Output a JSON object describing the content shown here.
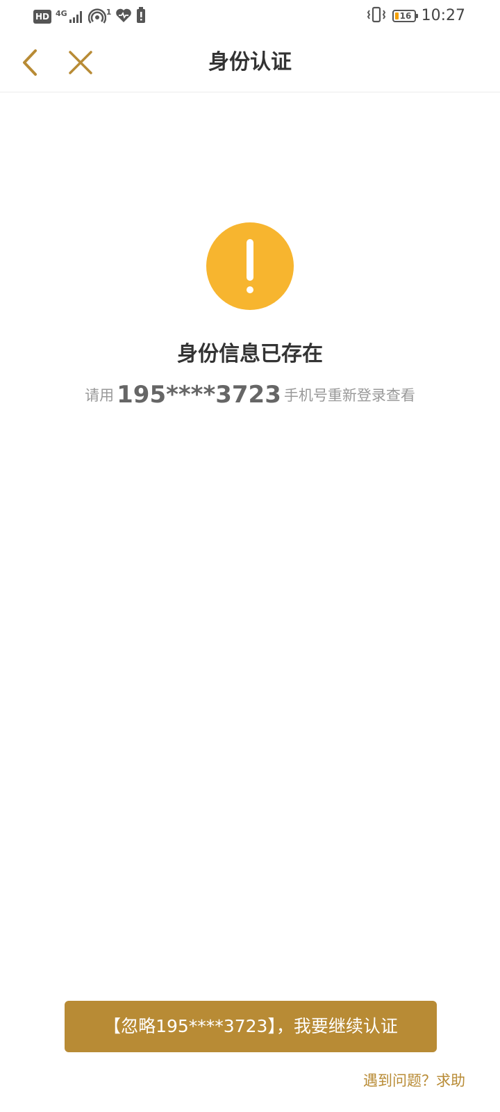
{
  "status_bar": {
    "hd": "HD",
    "network": "4G",
    "hotspot_count": "1",
    "battery_level": "16",
    "time": "10:27",
    "icons": [
      "hd-icon",
      "signal-icon",
      "hotspot-icon",
      "health-icon",
      "alert-icon",
      "vibrate-icon",
      "battery-icon"
    ]
  },
  "header": {
    "title": "身份认证",
    "back_icon": "chevron-left-icon",
    "close_icon": "close-icon"
  },
  "result": {
    "icon": "warning-icon",
    "title": "身份信息已存在",
    "desc_prefix": "请用",
    "phone": "195****3723",
    "desc_suffix": "手机号重新登录查看"
  },
  "actions": {
    "continue_label": "【忽略195****3723】，我要继续认证",
    "help_label": "遇到问题？求助"
  },
  "colors": {
    "accent": "#b88b35",
    "warning": "#f7b52f"
  }
}
